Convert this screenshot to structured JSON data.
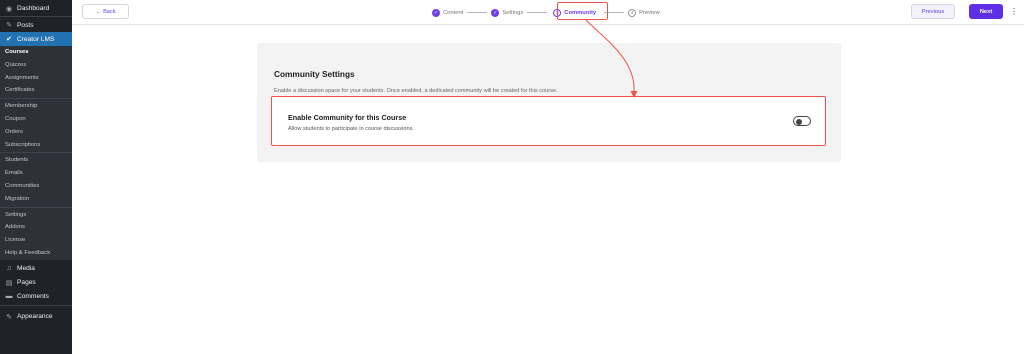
{
  "sidebar": {
    "top": [
      {
        "label": "Dashboard",
        "icon": "dashboard-icon",
        "glyph": "◉"
      },
      {
        "label": "Posts",
        "icon": "pin-icon",
        "glyph": "✎"
      }
    ],
    "active": {
      "label": "Creator LMS",
      "icon": "creator-lms-icon",
      "glyph": "✔"
    },
    "group1": [
      "Courses",
      "Quizzes",
      "Assignments",
      "Certificates"
    ],
    "group2": [
      "Membership",
      "Coupon",
      "Orders",
      "Subscriptions"
    ],
    "group3": [
      "Students",
      "Emails",
      "Communities",
      "Migration"
    ],
    "group4": [
      "Settings",
      "Addons",
      "License",
      "Help & Feedback"
    ],
    "bottom": [
      {
        "label": "Media",
        "icon": "media-icon",
        "glyph": "♫"
      },
      {
        "label": "Pages",
        "icon": "pages-icon",
        "glyph": "▤"
      },
      {
        "label": "Comments",
        "icon": "comments-icon",
        "glyph": "▬"
      },
      {
        "label": "Appearance",
        "icon": "appearance-icon",
        "glyph": "✎"
      }
    ]
  },
  "topbar": {
    "back_label": "Back",
    "steps": [
      {
        "label": "Content",
        "state": "done",
        "num": "1"
      },
      {
        "label": "Settings",
        "state": "done",
        "num": "2"
      },
      {
        "label": "Community",
        "state": "active",
        "num": "3"
      },
      {
        "label": "Preview",
        "state": "todo",
        "num": "4"
      }
    ],
    "previous_label": "Previous",
    "next_label": "Next"
  },
  "community": {
    "title": "Community Settings",
    "description": "Enable a discussion space for your students. Once enabled, a dedicated community will be created for this course.",
    "toggle_title": "Enable Community for this Course",
    "toggle_description": "Allow students to participate in course discussions.",
    "enabled": false
  },
  "colors": {
    "accent": "#6c3ee8",
    "sidebar_bg": "#1d2327",
    "sidebar_active": "#2271b1",
    "annotation": "#f0534c"
  }
}
